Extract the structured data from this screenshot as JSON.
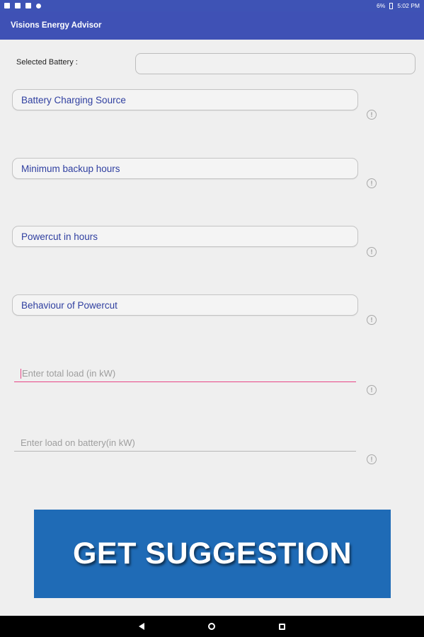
{
  "status_bar": {
    "battery_percent": "6%",
    "time": "5:02 PM"
  },
  "app_bar": {
    "title": "Visions Energy Advisor"
  },
  "form": {
    "selected_battery_label": "Selected Battery :",
    "selected_battery_value": "",
    "charging_source": "Battery Charging Source",
    "min_backup_hours": "Minimum backup hours",
    "powercut_hours": "Powercut in hours",
    "powercut_behaviour": "Behaviour of Powercut",
    "total_load_placeholder": "Enter total load (in kW)",
    "battery_load_placeholder": "Enter load on battery(in kW)"
  },
  "info_icon_glyph": "!",
  "button": {
    "label": "GET SUGGESTION"
  },
  "colors": {
    "app_bar": "#3f51b5",
    "focus_accent": "#e74585",
    "button": "#1f6bb6"
  }
}
